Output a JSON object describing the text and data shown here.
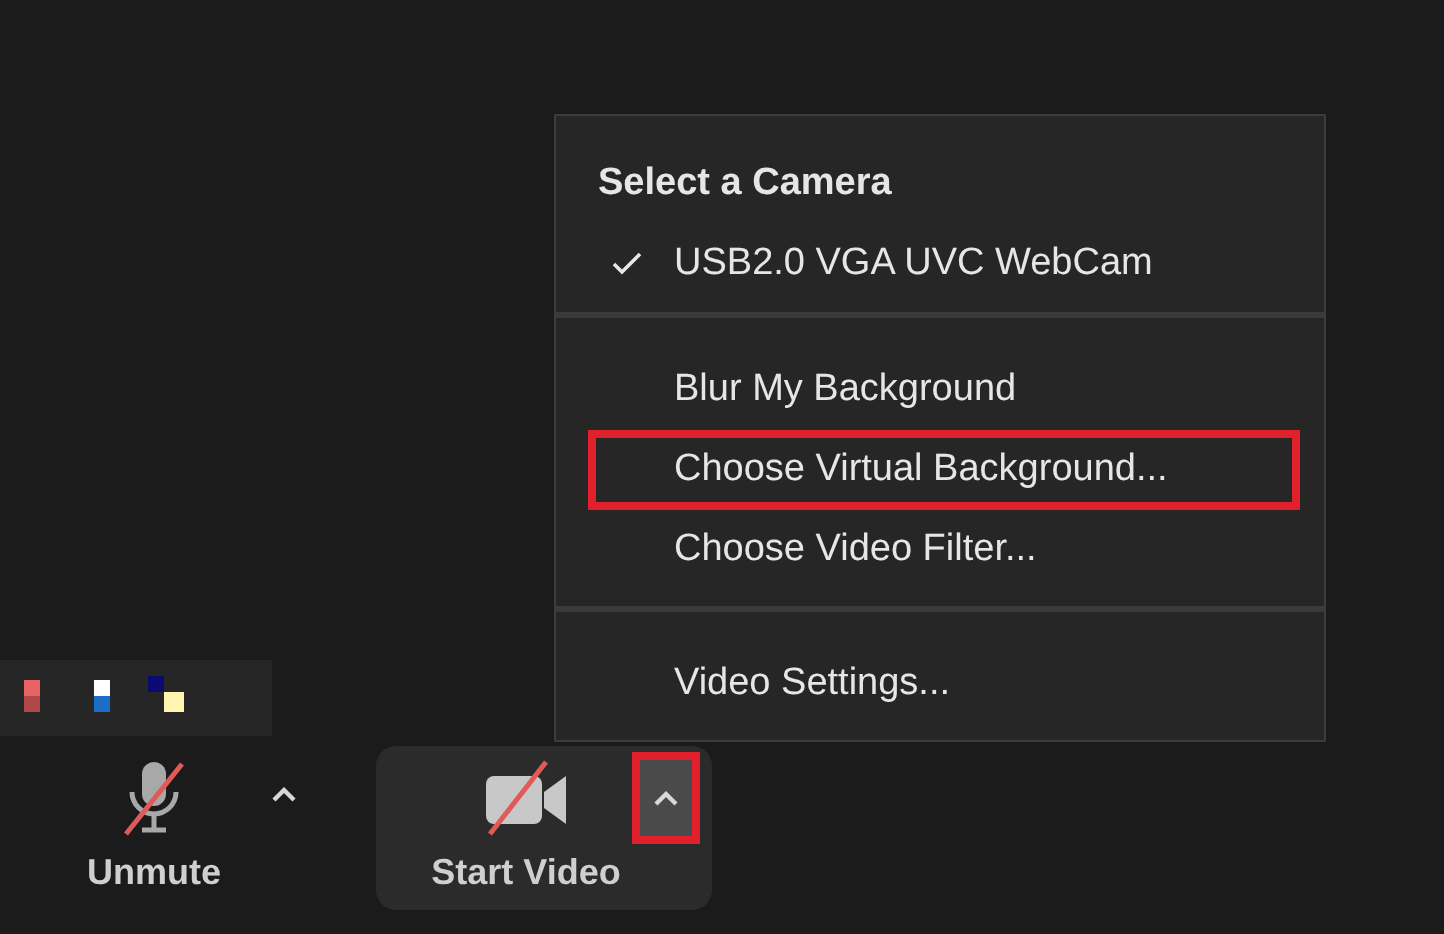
{
  "menu": {
    "title": "Select a Camera",
    "sections": [
      {
        "items": [
          {
            "label": "USB2.0 VGA UVC WebCam",
            "checked": true,
            "highlighted": false
          }
        ]
      },
      {
        "items": [
          {
            "label": "Blur My Background",
            "checked": false,
            "highlighted": false
          },
          {
            "label": "Choose Virtual Background...",
            "checked": false,
            "highlighted": true
          },
          {
            "label": "Choose Video Filter...",
            "checked": false,
            "highlighted": false
          }
        ]
      },
      {
        "items": [
          {
            "label": "Video Settings...",
            "checked": false,
            "highlighted": false
          }
        ]
      }
    ]
  },
  "toolbar": {
    "buttons": [
      {
        "label": "Unmute",
        "kind": "mic",
        "muted": true,
        "selected": false,
        "caret_highlighted": false
      },
      {
        "label": "Start Video",
        "kind": "video",
        "muted": true,
        "selected": true,
        "caret_highlighted": true
      }
    ]
  }
}
